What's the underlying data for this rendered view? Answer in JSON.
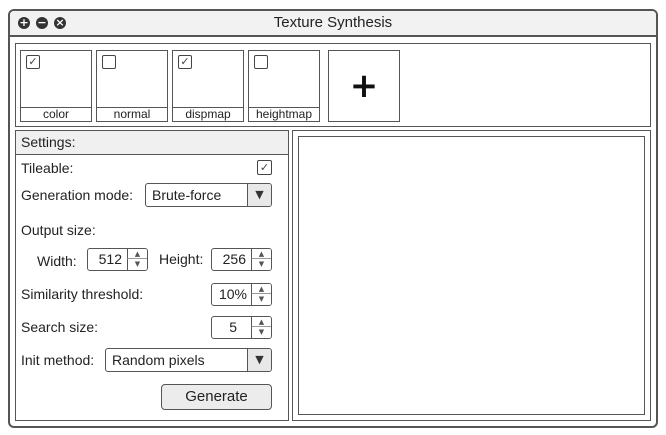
{
  "window": {
    "title": "Texture Synthesis",
    "controls": [
      "add-icon",
      "minus-icon",
      "close-icon"
    ]
  },
  "toolbar": {
    "tiles": [
      {
        "label": "color",
        "checked": true
      },
      {
        "label": "normal",
        "checked": false
      },
      {
        "label": "dispmap",
        "checked": true
      },
      {
        "label": "heightmap",
        "checked": false
      }
    ],
    "add_tile_glyph": "+"
  },
  "settings": {
    "header": "Settings:",
    "tileable": {
      "label": "Tileable:",
      "checked": true
    },
    "generation_mode": {
      "label": "Generation mode:",
      "value": "Brute-force"
    },
    "output_size": {
      "label": "Output size:",
      "width_label": "Width:",
      "width_value": "512",
      "height_label": "Height:",
      "height_value": "256"
    },
    "similarity_threshold": {
      "label": "Similarity threshold:",
      "value": "10%"
    },
    "search_size": {
      "label": "Search size:",
      "value": "5"
    },
    "init_method": {
      "label": "Init method:",
      "value": "Random pixels"
    },
    "generate_label": "Generate"
  },
  "glyphs": {
    "check": "✓",
    "dropdown": "▼",
    "spin_up": "▲",
    "spin_down": "▼"
  }
}
